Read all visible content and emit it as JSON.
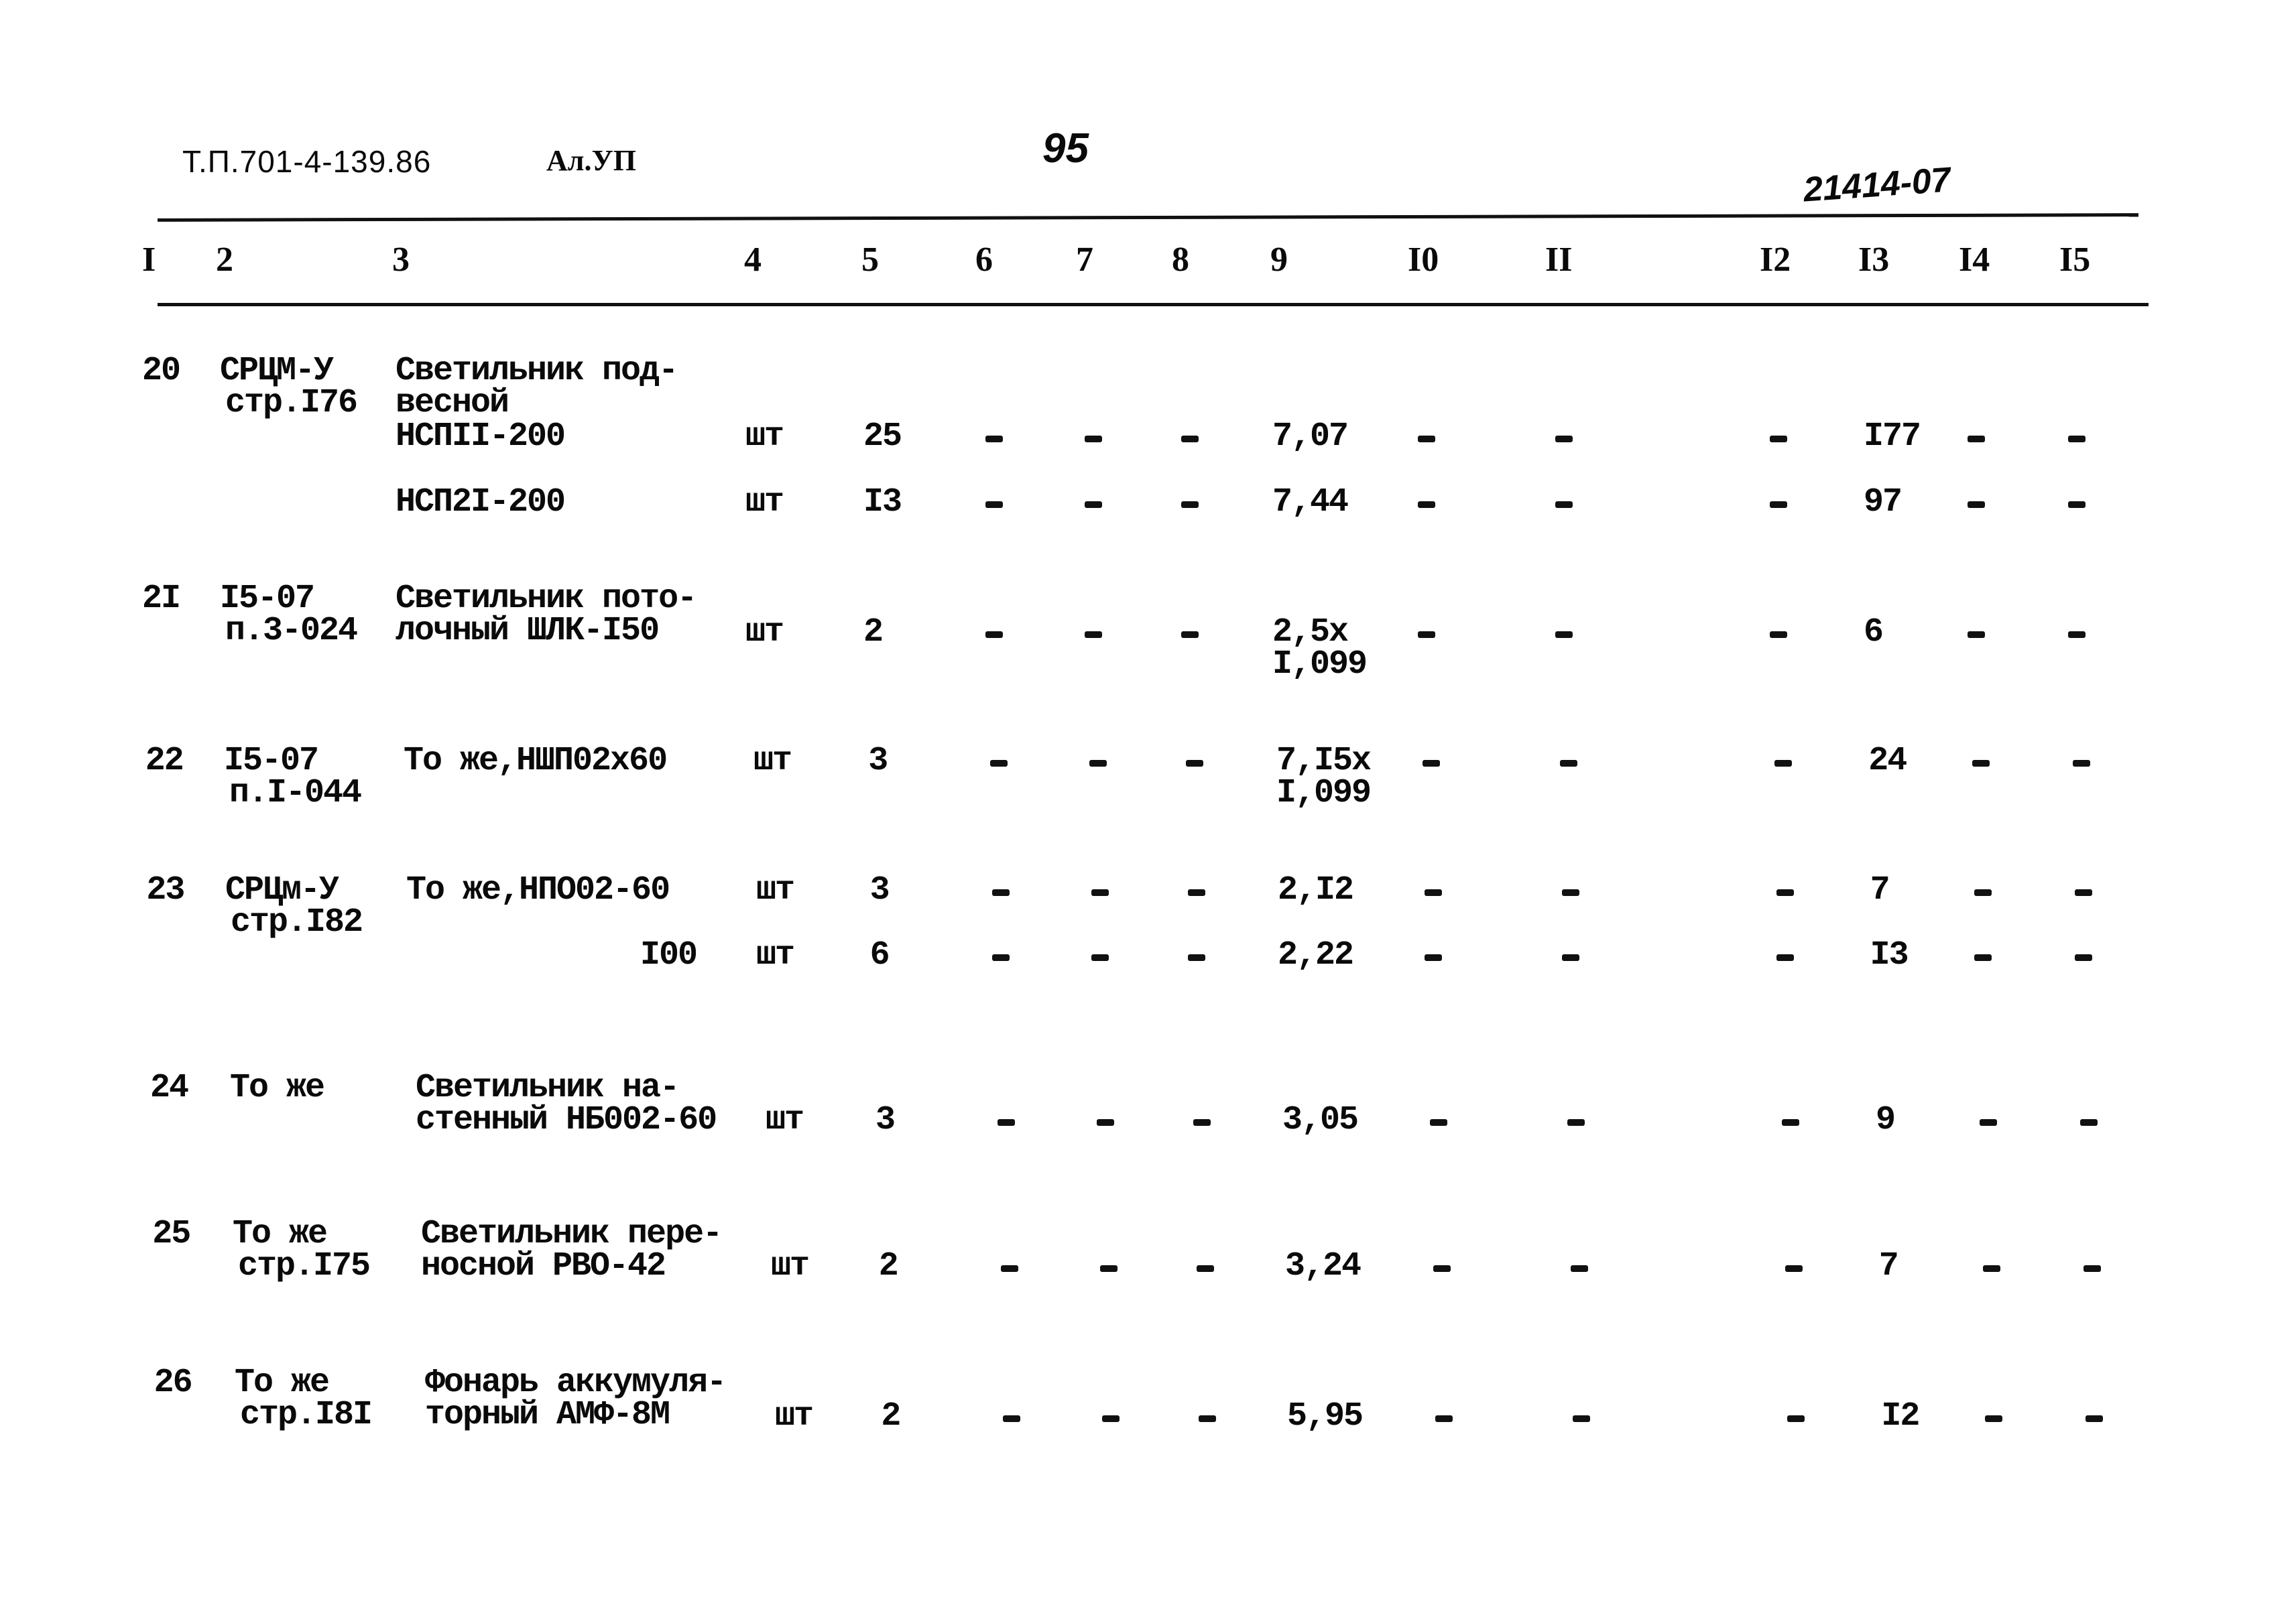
{
  "header": {
    "doc_ref": "Т.П.701-4-139.86",
    "sheet": "Ал.УП",
    "page_number": "95",
    "archive_code": "21414-07"
  },
  "columns": [
    "I",
    "2",
    "3",
    "4",
    "5",
    "6",
    "7",
    "8",
    "9",
    "I0",
    "II",
    "I2",
    "I3",
    "I4",
    "I5"
  ],
  "rows": [
    {
      "no": "20",
      "ref": [
        "СРЦМ-У",
        "стр.I76"
      ],
      "name": [
        "Светильник под-",
        "весной"
      ],
      "items": [
        {
          "name": "НСПII-200",
          "unit": "шт",
          "qty": "25",
          "c6": "-",
          "c7": "-",
          "c8": "-",
          "c9": [
            "7,07"
          ],
          "c10": "-",
          "c11": "-",
          "c12": "-",
          "c13": "I77",
          "c14": "-",
          "c15": "-"
        },
        {
          "name": "НСП2I-200",
          "unit": "шт",
          "qty": "I3",
          "c6": "-",
          "c7": "-",
          "c8": "-",
          "c9": [
            "7,44"
          ],
          "c10": "-",
          "c11": "-",
          "c12": "-",
          "c13": "97",
          "c14": "-",
          "c15": "-"
        }
      ]
    },
    {
      "no": "2I",
      "ref": [
        "I5-07",
        "п.3-024"
      ],
      "name": [
        "Светильник пото-",
        "лочный ШЛК-I50"
      ],
      "items": [
        {
          "name": "",
          "unit": "шт",
          "qty": "2",
          "c6": "-",
          "c7": "-",
          "c8": "-",
          "c9": [
            "2,5х",
            "I,099"
          ],
          "c10": "-",
          "c11": "-",
          "c12": "-",
          "c13": "6",
          "c14": "-",
          "c15": "-"
        }
      ]
    },
    {
      "no": "22",
      "ref": [
        "I5-07",
        "п.I-044"
      ],
      "name": [
        "То же,НШП02х60"
      ],
      "items": [
        {
          "name": "",
          "unit": "шт",
          "qty": "3",
          "c6": "-",
          "c7": "-",
          "c8": "-",
          "c9": [
            "7,I5х",
            "I,099"
          ],
          "c10": "-",
          "c11": "-",
          "c12": "-",
          "c13": "24",
          "c14": "-",
          "c15": "-"
        }
      ]
    },
    {
      "no": "23",
      "ref": [
        "СРЦм-У",
        "стр.I82"
      ],
      "name": [
        "То же,НПО02-60"
      ],
      "items": [
        {
          "name": "",
          "unit": "шт",
          "qty": "3",
          "c6": "-",
          "c7": "-",
          "c8": "-",
          "c9": [
            "2,I2"
          ],
          "c10": "-",
          "c11": "-",
          "c12": "-",
          "c13": "7",
          "c14": "-",
          "c15": "-"
        },
        {
          "name": "I00",
          "unit": "шт",
          "qty": "6",
          "c6": "-",
          "c7": "-",
          "c8": "-",
          "c9": [
            "2,22"
          ],
          "c10": "-",
          "c11": "-",
          "c12": "-",
          "c13": "I3",
          "c14": "-",
          "c15": "-"
        }
      ]
    },
    {
      "no": "24",
      "ref": [
        "То же"
      ],
      "name": [
        "Светильник на-",
        "стенный НБ002-60"
      ],
      "items": [
        {
          "name": "",
          "unit": "шт",
          "qty": "3",
          "c6": "-",
          "c7": "-",
          "c8": "-",
          "c9": [
            "3,05"
          ],
          "c10": "-",
          "c11": "-",
          "c12": "-",
          "c13": "9",
          "c14": "-",
          "c15": "-"
        }
      ]
    },
    {
      "no": "25",
      "ref": [
        "То же",
        "стр.I75"
      ],
      "name": [
        "Светильник пере-",
        "носной РВО-42"
      ],
      "items": [
        {
          "name": "",
          "unit": "шт",
          "qty": "2",
          "c6": "-",
          "c7": "-",
          "c8": "-",
          "c9": [
            "3,24"
          ],
          "c10": "-",
          "c11": "-",
          "c12": "-",
          "c13": "7",
          "c14": "-",
          "c15": "-"
        }
      ]
    },
    {
      "no": "26",
      "ref": [
        "То же",
        "стр.I8I"
      ],
      "name": [
        "Фонарь аккумуля-",
        "торный АМФ-8М"
      ],
      "items": [
        {
          "name": "",
          "unit": "шт",
          "qty": "2",
          "c6": "-",
          "c7": "-",
          "c8": "-",
          "c9": [
            "5,95"
          ],
          "c10": "-",
          "c11": "-",
          "c12": "-",
          "c13": "I2",
          "c14": "-",
          "c15": "-"
        }
      ]
    }
  ]
}
